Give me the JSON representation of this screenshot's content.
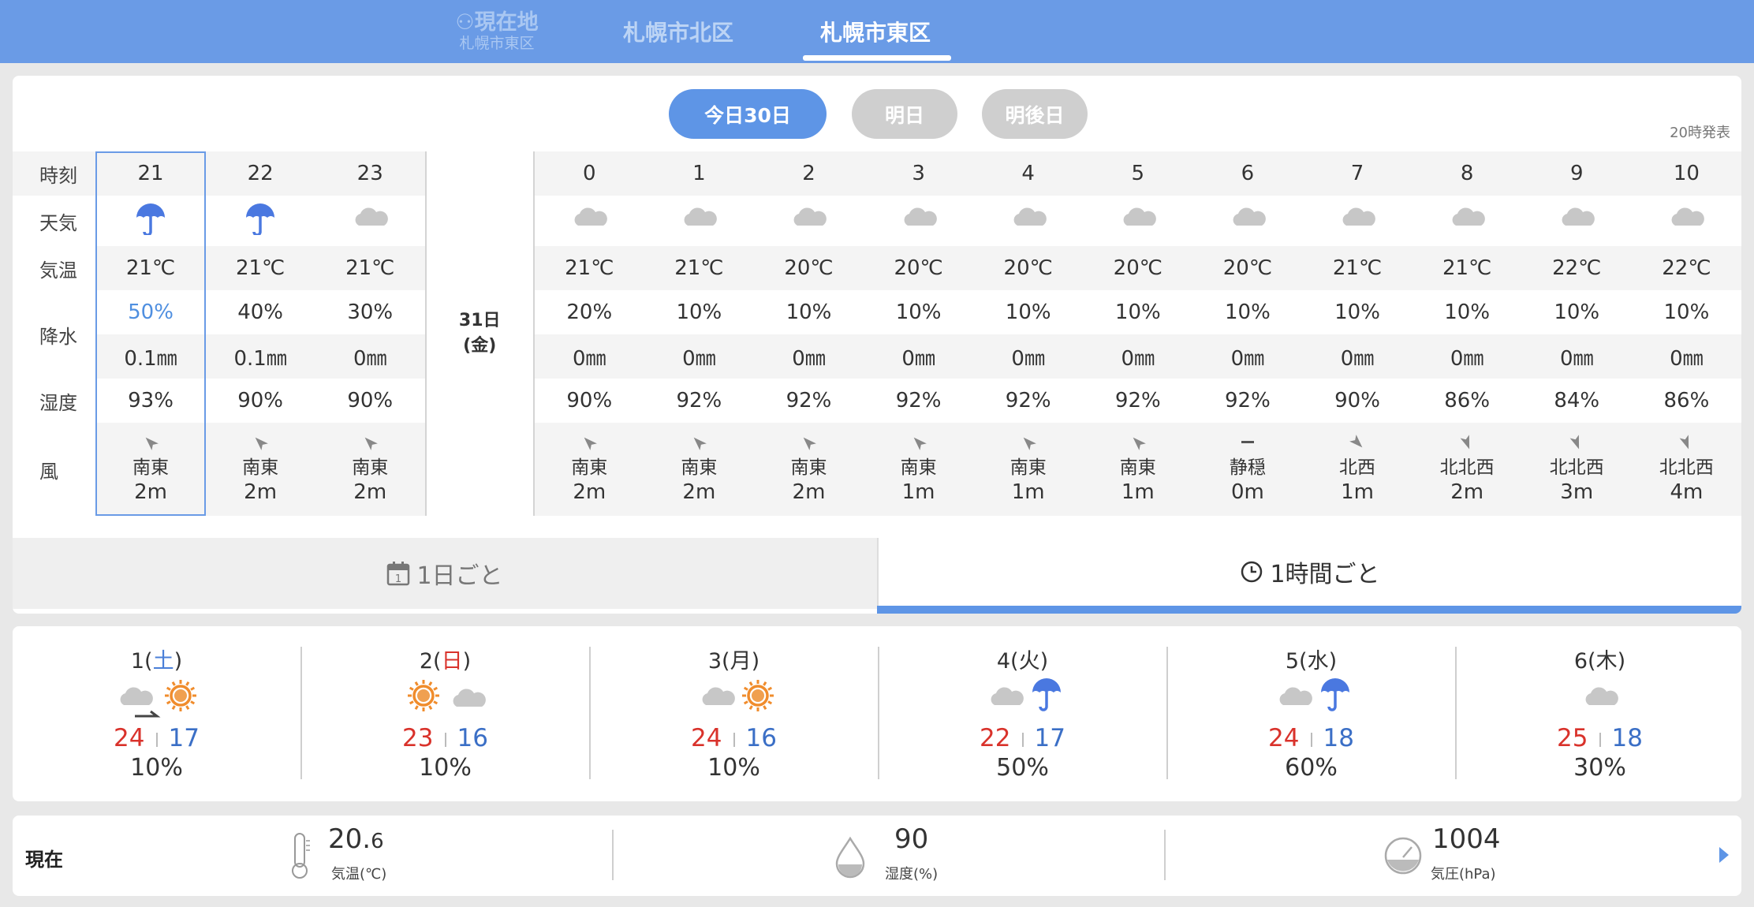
{
  "header": {
    "current_location_label": "⚇現在地",
    "current_location_sub": "札幌市東区",
    "tabs": [
      "札幌市北区",
      "札幌市東区"
    ],
    "active_tab": "札幌市東区"
  },
  "day_tabs": [
    "今日30日",
    "明日",
    "明後日"
  ],
  "active_day_tab": "今日30日",
  "issued": "20時発表",
  "row_labels": {
    "time": "時刻",
    "weather": "天気",
    "temp": "気温",
    "precip": "降水",
    "humidity": "湿度",
    "wind": "風"
  },
  "date_separator": [
    "31日",
    "(金)"
  ],
  "hours_today": [
    {
      "hour": "21",
      "weather": "rain-icon",
      "temp": "21℃",
      "pop": "50%",
      "precip": "0.1㎜",
      "humidity": "93%",
      "wind_dir": "南東",
      "wind_speed": "2m",
      "wind_arrow": "nw"
    },
    {
      "hour": "22",
      "weather": "rain-icon",
      "temp": "21℃",
      "pop": "40%",
      "precip": "0.1㎜",
      "humidity": "90%",
      "wind_dir": "南東",
      "wind_speed": "2m",
      "wind_arrow": "nw"
    },
    {
      "hour": "23",
      "weather": "cloud-icon",
      "temp": "21℃",
      "pop": "30%",
      "precip": "0㎜",
      "humidity": "90%",
      "wind_dir": "南東",
      "wind_speed": "2m",
      "wind_arrow": "nw"
    }
  ],
  "hours_tomorrow": [
    {
      "hour": "0",
      "weather": "cloud-icon",
      "temp": "21℃",
      "pop": "20%",
      "precip": "0㎜",
      "humidity": "90%",
      "wind_dir": "南東",
      "wind_speed": "2m",
      "wind_arrow": "nw"
    },
    {
      "hour": "1",
      "weather": "cloud-icon",
      "temp": "21℃",
      "pop": "10%",
      "precip": "0㎜",
      "humidity": "92%",
      "wind_dir": "南東",
      "wind_speed": "2m",
      "wind_arrow": "nw"
    },
    {
      "hour": "2",
      "weather": "cloud-icon",
      "temp": "20℃",
      "pop": "10%",
      "precip": "0㎜",
      "humidity": "92%",
      "wind_dir": "南東",
      "wind_speed": "2m",
      "wind_arrow": "nw"
    },
    {
      "hour": "3",
      "weather": "cloud-icon",
      "temp": "20℃",
      "pop": "10%",
      "precip": "0㎜",
      "humidity": "92%",
      "wind_dir": "南東",
      "wind_speed": "1m",
      "wind_arrow": "nw"
    },
    {
      "hour": "4",
      "weather": "cloud-icon",
      "temp": "20℃",
      "pop": "10%",
      "precip": "0㎜",
      "humidity": "92%",
      "wind_dir": "南東",
      "wind_speed": "1m",
      "wind_arrow": "nw"
    },
    {
      "hour": "5",
      "weather": "cloud-icon",
      "temp": "20℃",
      "pop": "10%",
      "precip": "0㎜",
      "humidity": "92%",
      "wind_dir": "南東",
      "wind_speed": "1m",
      "wind_arrow": "nw"
    },
    {
      "hour": "6",
      "weather": "cloud-icon",
      "temp": "20℃",
      "pop": "10%",
      "precip": "0㎜",
      "humidity": "92%",
      "wind_dir": "静穏",
      "wind_speed": "0m",
      "wind_arrow": "calm"
    },
    {
      "hour": "7",
      "weather": "cloud-icon",
      "temp": "21℃",
      "pop": "10%",
      "precip": "0㎜",
      "humidity": "90%",
      "wind_dir": "北西",
      "wind_speed": "1m",
      "wind_arrow": "se"
    },
    {
      "hour": "8",
      "weather": "cloud-icon",
      "temp": "21℃",
      "pop": "10%",
      "precip": "0㎜",
      "humidity": "86%",
      "wind_dir": "北北西",
      "wind_speed": "2m",
      "wind_arrow": "s"
    },
    {
      "hour": "9",
      "weather": "cloud-icon",
      "temp": "22℃",
      "pop": "10%",
      "precip": "0㎜",
      "humidity": "84%",
      "wind_dir": "北北西",
      "wind_speed": "3m",
      "wind_arrow": "s"
    },
    {
      "hour": "10",
      "weather": "cloud-icon",
      "temp": "22℃",
      "pop": "10%",
      "precip": "0㎜",
      "humidity": "86%",
      "wind_dir": "北北西",
      "wind_speed": "4m",
      "wind_arrow": "s"
    }
  ],
  "mode_tabs": {
    "daily": "1日ごと",
    "hourly": "1時間ごと",
    "active": "hourly"
  },
  "weekly": [
    {
      "day": "1",
      "weekday": "土",
      "weekday_type": "sat",
      "icon": "cloud-then-sun-icon",
      "high": "24",
      "low": "17",
      "pop": "10%"
    },
    {
      "day": "2",
      "weekday": "日",
      "weekday_type": "sun",
      "icon": "sun-then-cloud-icon",
      "high": "23",
      "low": "16",
      "pop": "10%"
    },
    {
      "day": "3",
      "weekday": "月",
      "weekday_type": "normal",
      "icon": "cloud-sun-icon",
      "high": "24",
      "low": "16",
      "pop": "10%"
    },
    {
      "day": "4",
      "weekday": "火",
      "weekday_type": "normal",
      "icon": "cloud-rain-icon",
      "high": "22",
      "low": "17",
      "pop": "50%"
    },
    {
      "day": "5",
      "weekday": "水",
      "weekday_type": "normal",
      "icon": "cloud-rain-icon",
      "high": "24",
      "low": "18",
      "pop": "60%"
    },
    {
      "day": "6",
      "weekday": "木",
      "weekday_type": "normal",
      "icon": "cloud-icon",
      "high": "25",
      "low": "18",
      "pop": "30%"
    }
  ],
  "current": {
    "label": "現在",
    "temp_int": "20.",
    "temp_dec": "6",
    "temp_label": "気温(℃)",
    "humidity": "90",
    "humidity_label": "湿度(%)",
    "pressure": "1004",
    "pressure_label": "気圧(hPa)"
  },
  "colors": {
    "accent": "#5e95e6",
    "header": "#6a9be6",
    "high": "#d9322b",
    "low": "#3b6fc6",
    "rain": "#4a78e0",
    "cloud": "#c7c7c7",
    "sun": "#f08c2c"
  }
}
